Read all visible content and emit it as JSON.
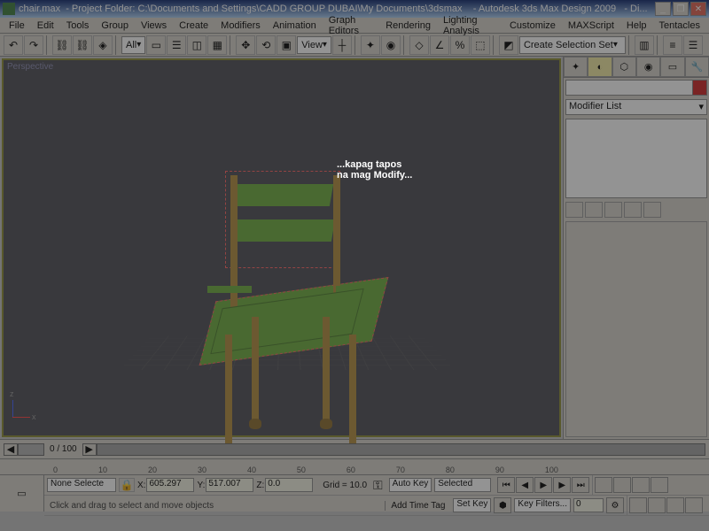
{
  "titlebar": {
    "file": "chair.max",
    "project": "- Project Folder: C:\\Documents and Settings\\CADD GROUP DUBAI\\My Documents\\3dsmax",
    "app": "- Autodesk 3ds Max Design 2009",
    "extra": "- Di..."
  },
  "menu": [
    "File",
    "Edit",
    "Tools",
    "Group",
    "Views",
    "Create",
    "Modifiers",
    "Animation",
    "Graph Editors",
    "Rendering",
    "Lighting Analysis",
    "Customize",
    "MAXScript",
    "Help",
    "Tentacles"
  ],
  "toolbar": {
    "all_dropdown": "All",
    "view_dropdown": "View",
    "selset": "Create Selection Set"
  },
  "viewport": {
    "label": "Perspective",
    "axis_z": "z",
    "axis_x": "x"
  },
  "cmdpanel": {
    "modifier_list": "Modifier List",
    "dropdown_arrow": "▾"
  },
  "timeline": {
    "frame_label": "0 / 100",
    "ticks": [
      "0",
      "10",
      "20",
      "30",
      "40",
      "50",
      "60",
      "70",
      "80",
      "90",
      "100"
    ]
  },
  "status": {
    "selection": "None Selecte",
    "x_label": "X:",
    "x_val": "605.297",
    "y_label": "Y:",
    "y_val": "517.007",
    "z_label": "Z:",
    "z_val": "0.0",
    "grid": "Grid = 10.0",
    "autokey": "Auto Key",
    "setkey": "Set Key",
    "selected": "Selected",
    "keyfilters": "Key Filters...",
    "hint": "Click and drag to select and move objects",
    "addtag": "Add Time Tag"
  },
  "overlay_text": {
    "line1": "...kapag tapos",
    "line2": "na mag Modify..."
  }
}
